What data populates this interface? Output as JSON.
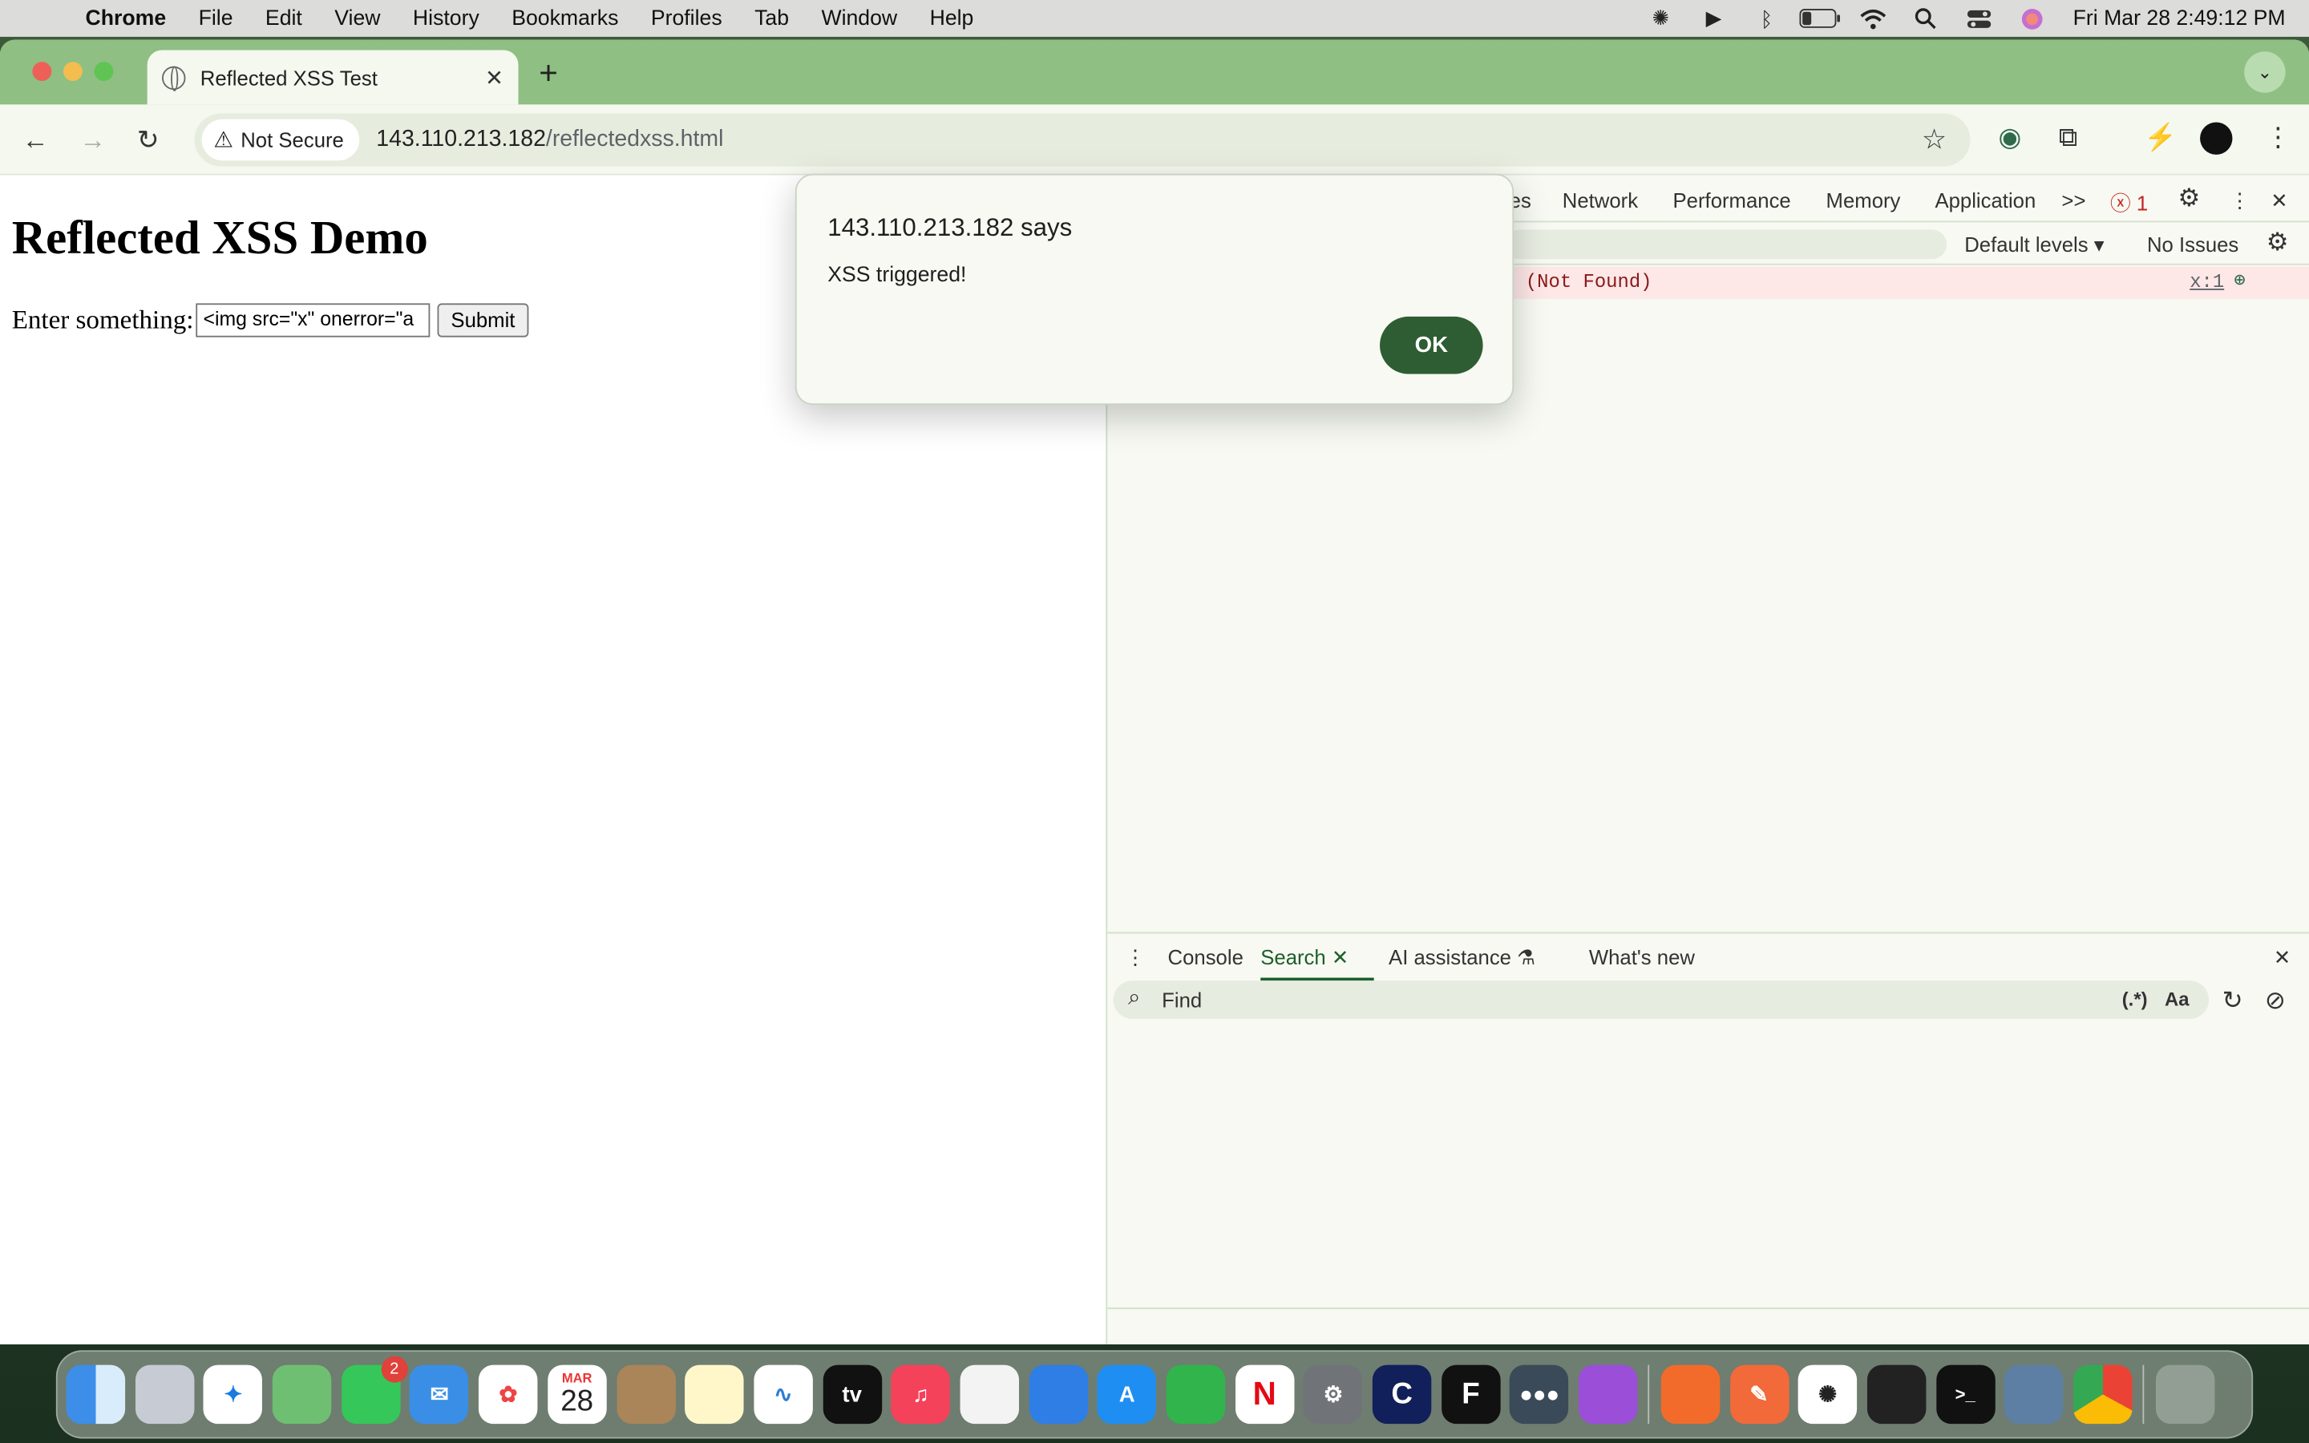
{
  "menubar": {
    "app": "Chrome",
    "items": [
      "File",
      "Edit",
      "View",
      "History",
      "Bookmarks",
      "Profiles",
      "Tab",
      "Window",
      "Help"
    ],
    "clock": "Fri Mar 28  2:49:12 PM"
  },
  "browser": {
    "tab_title": "Reflected XSS Test",
    "security_chip": "Not Secure",
    "url_host": "143.110.213.182",
    "url_path": "/reflectedxss.html"
  },
  "page": {
    "heading": "Reflected XSS Demo",
    "input_label": "Enter something:",
    "input_value": "<img src=\"x\" onerror=\"a",
    "submit_label": "Submit"
  },
  "alert": {
    "title": "143.110.213.182 says",
    "message": "XSS triggered!",
    "ok_label": "OK"
  },
  "devtools": {
    "tabs": [
      "es",
      "Network",
      "Performance",
      "Memory",
      "Application"
    ],
    "more": ">>",
    "error_count": "1",
    "levels_label": "Default levels ▾",
    "issues_label": "No Issues",
    "error_message": "(Not Found)",
    "error_source": "x:1",
    "drawer_tabs": {
      "console": "Console",
      "search": "Search",
      "ai": "AI assistance",
      "whats_new": "What's new"
    },
    "find_placeholder": "Find",
    "regex_label": "(.*)",
    "case_label": "Aa"
  },
  "dock": {
    "calendar_month": "MAR",
    "calendar_day": "28",
    "messages_badge": "2",
    "tv_label": "tv",
    "app_letters": {
      "netflix": "N",
      "f": "F",
      "c": "C"
    }
  }
}
